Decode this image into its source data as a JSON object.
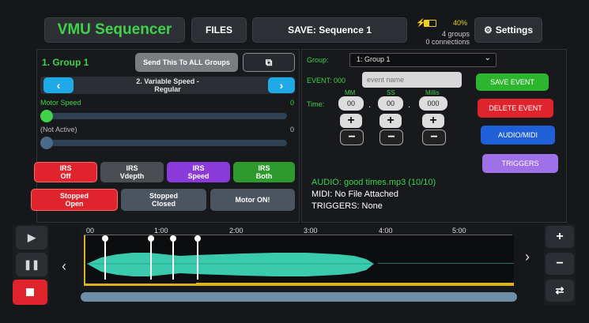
{
  "header": {
    "app_title": "VMU Sequencer",
    "files_label": "FILES",
    "save_label": "SAVE: Sequence 1",
    "battery": "40%",
    "groups": "4 groups",
    "connections": "0 connections",
    "settings_label": "Settings"
  },
  "left": {
    "group_title": "1. Group 1",
    "send_all_label": "Send This To ALL Groups",
    "prev_label": "‹",
    "next_label": "›",
    "profile_line1": "2. Variable Speed -",
    "profile_line2": "Regular",
    "motor_speed_label": "Motor Speed",
    "motor_speed_value": "0",
    "inactive_label": "(Not Active)",
    "inactive_value": "0",
    "irs_buttons": [
      {
        "line1": "IRS",
        "line2": "Off",
        "color": "#e0242e"
      },
      {
        "line1": "IRS",
        "line2": "Vdepth",
        "color": "#4a4d52"
      },
      {
        "line1": "IRS",
        "line2": "Speed",
        "color": "#8a3ad8"
      },
      {
        "line1": "IRS",
        "line2": "Both",
        "color": "#2e9a2e"
      }
    ],
    "stopped_open_1": "Stopped",
    "stopped_open_2": "Open",
    "stopped_closed_1": "Stopped",
    "stopped_closed_2": "Closed",
    "motor_on": "Motor ON!"
  },
  "right": {
    "group_label": "Group:",
    "group_value": "1: Group 1",
    "event_label": "EVENT: 000",
    "event_placeholder": "event name",
    "time_label": "Time:",
    "mm_label": "MM",
    "ss_label": "SS",
    "millis_label": "Millis",
    "mm_value": "00",
    "ss_value": "00",
    "millis_value": "000",
    "time_sep": ".",
    "plus": "+",
    "minus": "−",
    "save_event": "SAVE EVENT",
    "delete_event": "DELETE EVENT",
    "audio_midi": "AUDIO/MIDI",
    "triggers": "TRIGGERS",
    "audio_info": "AUDIO: good times.mp3  (10/10)",
    "midi_info": "MIDI: No File Attached",
    "triggers_info": "TRIGGERS: None"
  },
  "timeline": {
    "ticks": [
      "00",
      "1:00",
      "2:00",
      "3:00",
      "4:00",
      "5:00"
    ],
    "prev": "‹",
    "next": "›",
    "playback_progress_percent": 0
  },
  "colors": {
    "green": "#3fd24a",
    "cyan": "#1fa9e8",
    "red": "#e0242e",
    "waveform": "#3fe0c0",
    "gold": "#d9b21c"
  }
}
